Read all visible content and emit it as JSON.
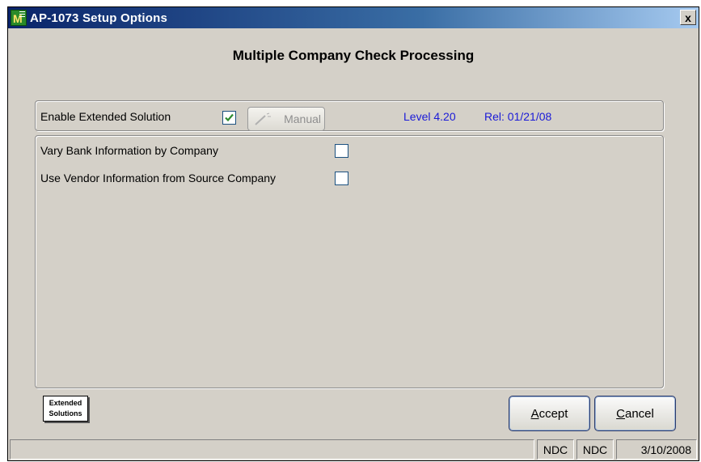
{
  "window": {
    "title": "AP-1073 Setup Options",
    "close_label": "x"
  },
  "heading": "Multiple Company Check Processing",
  "top_group": {
    "enable_label": "Enable Extended Solution",
    "enable_checked": true,
    "manual_label": "Manual",
    "level_text": "Level 4.20",
    "release_text": "Rel: 01/21/08"
  },
  "options": [
    {
      "label": "Vary Bank Information by Company",
      "checked": false
    },
    {
      "label": "Use Vendor Information from Source Company",
      "checked": false
    }
  ],
  "logo": {
    "line1": "Extended",
    "line2": "Solutions"
  },
  "buttons": {
    "accept_accel": "A",
    "accept_rest": "ccept",
    "cancel_accel": "C",
    "cancel_rest": "ancel"
  },
  "statusbar": {
    "main": "",
    "company": "NDC",
    "user": "NDC",
    "date": "3/10/2008"
  },
  "colors": {
    "title_gradient_start": "#0a246a",
    "dialog_bg": "#d4d0c8",
    "info_text": "#1a1ad8",
    "checkmark": "#2e8b2e"
  }
}
